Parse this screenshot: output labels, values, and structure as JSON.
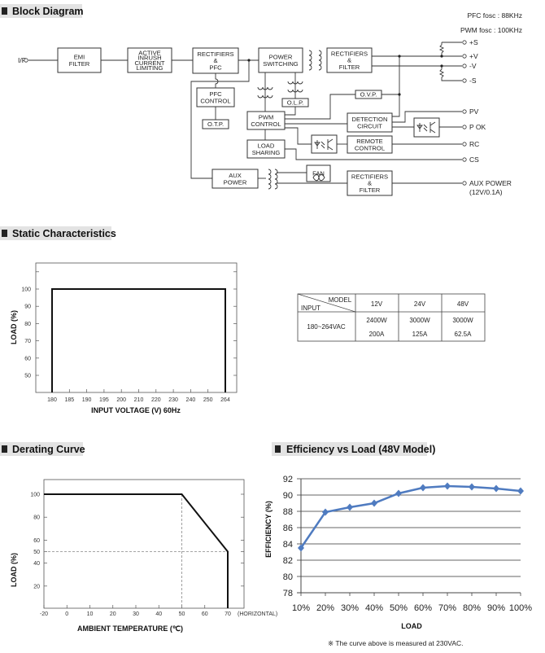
{
  "block_diagram": {
    "title": "Block Diagram",
    "pfc_fosc": "PFC fosc : 88KHz",
    "pwm_fosc": "PWM fosc : 100KHz",
    "input_label": "I/P",
    "boxes": {
      "emi": [
        "EMI",
        "FILTER"
      ],
      "inrush": [
        "ACTIVE",
        "INRUSH",
        "CURRENT",
        "LIMITING"
      ],
      "rect_pfc": [
        "RECTIFIERS",
        "&",
        "PFC"
      ],
      "power_switching": [
        "POWER",
        "SWITCHING"
      ],
      "rect_filter_main": [
        "RECTIFIERS",
        "&",
        "FILTER"
      ],
      "pfc_control": [
        "PFC",
        "CONTROL"
      ],
      "otp": [
        "O.T.P."
      ],
      "pwm_control": [
        "PWM",
        "CONTROL"
      ],
      "olp": [
        "O.L.P."
      ],
      "ovp": [
        "O.V.P."
      ],
      "detection": [
        "DETECTION",
        "CIRCUIT"
      ],
      "remote": [
        "REMOTE",
        "CONTROL"
      ],
      "load_sharing": [
        "LOAD",
        "SHARING"
      ],
      "aux_power": [
        "AUX",
        "POWER"
      ],
      "fan": [
        "FAN"
      ],
      "rect_filter_aux": [
        "RECTIFIERS",
        "&",
        "FILTER"
      ]
    },
    "outputs": {
      "plus_s": "+S",
      "plus_v": "+V",
      "minus_v": "-V",
      "minus_s": "-S",
      "pv": "PV",
      "pok": "P OK",
      "rc": "RC",
      "cs": "CS",
      "aux": "AUX POWER",
      "aux_spec": "(12V/0.1A)"
    }
  },
  "static": {
    "title": "Static Characteristics",
    "table": {
      "corner_model": "MODEL",
      "corner_input": "INPUT",
      "columns": [
        "12V",
        "24V",
        "48V"
      ],
      "row_label": "180~264VAC",
      "watts": [
        "2400W",
        "3000W",
        "3000W"
      ],
      "amps": [
        "200A",
        "125A",
        "62.5A"
      ]
    }
  },
  "derating": {
    "title": "Derating Curve",
    "horizontal_note": "(HORIZONTAL)"
  },
  "efficiency": {
    "title": "Efficiency vs Load (48V Model)",
    "footnote": "※ The curve above is measured at 230VAC."
  },
  "chart_data": [
    {
      "type": "line",
      "name": "static",
      "xlabel": "INPUT VOLTAGE (V) 60Hz",
      "ylabel": "LOAD (%)",
      "x_ticks": [
        "180",
        "185",
        "190",
        "195",
        "200",
        "210",
        "220",
        "230",
        "240",
        "250",
        "264"
      ],
      "y_ticks": [
        50,
        60,
        70,
        80,
        90,
        100
      ],
      "x": [
        180,
        180,
        264,
        264
      ],
      "y": [
        40,
        100,
        100,
        40
      ],
      "grid": false
    },
    {
      "type": "line",
      "name": "derating",
      "xlabel": "AMBIENT TEMPERATURE (℃)",
      "ylabel": "LOAD (%)",
      "x_ticks": [
        "-20",
        "0",
        "10",
        "20",
        "30",
        "40",
        "50",
        "60",
        "70"
      ],
      "y_ticks": [
        20,
        40,
        50,
        60,
        80,
        100
      ],
      "x": [
        -20,
        50,
        70,
        70
      ],
      "y": [
        100,
        100,
        50,
        0
      ],
      "reference_lines": {
        "x": 50,
        "y": 50
      },
      "grid": false
    },
    {
      "type": "line",
      "name": "efficiency",
      "xlabel": "LOAD",
      "ylabel": "EFFICIENCY (%)",
      "categories": [
        "10%",
        "20%",
        "30%",
        "40%",
        "50%",
        "60%",
        "70%",
        "80%",
        "90%",
        "100%"
      ],
      "values": [
        83.5,
        87.9,
        88.5,
        89.0,
        90.2,
        90.9,
        91.1,
        91.0,
        90.8,
        90.5
      ],
      "y_ticks": [
        78,
        80,
        82,
        84,
        86,
        88,
        90,
        92
      ],
      "ylim": [
        78,
        92
      ],
      "grid": true,
      "color": "#4f7bc0",
      "marker": "diamond"
    }
  ]
}
